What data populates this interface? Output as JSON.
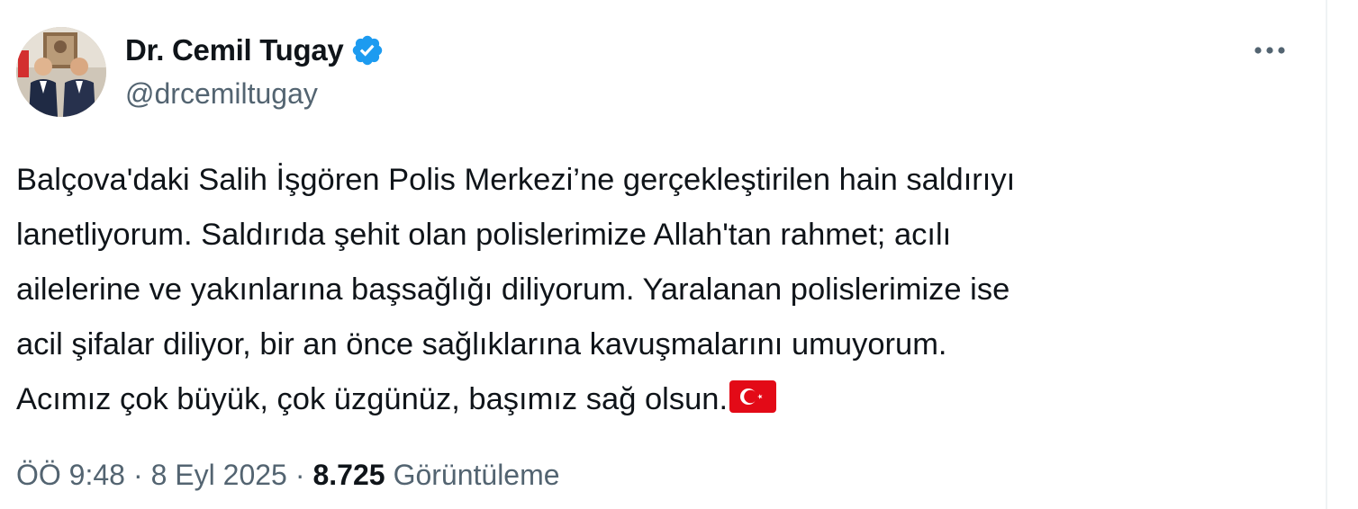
{
  "author": {
    "display_name": "Dr. Cemil Tugay",
    "handle": "@drcemiltugay",
    "verified": true,
    "verified_color": "#1d9bf0"
  },
  "tweet": {
    "lines": [
      "Balçova'daki Salih İşgören Polis Merkezi’ne gerçekleştirilen hain saldırıyı",
      "lanetliyorum. Saldırıda şehit olan polislerimize Allah'tan rahmet; acılı",
      "ailelerine ve yakınlarına başsağlığı diliyorum. Yaralanan polislerimize ise",
      "acil şifalar diliyor, bir an önce sağlıklarına kavuşmalarını umuyorum.",
      "Acımız çok büyük, çok üzgünüz, başımız sağ olsun."
    ],
    "emoji": "flag-turkey"
  },
  "meta": {
    "time": "ÖÖ 9:48",
    "separator": "·",
    "date": "8 Eyl 2025",
    "views_count": "8.725",
    "views_label": "Görüntüleme"
  },
  "colors": {
    "text_primary": "#0f1419",
    "text_secondary": "#536471",
    "flag_red": "#e30a17"
  }
}
